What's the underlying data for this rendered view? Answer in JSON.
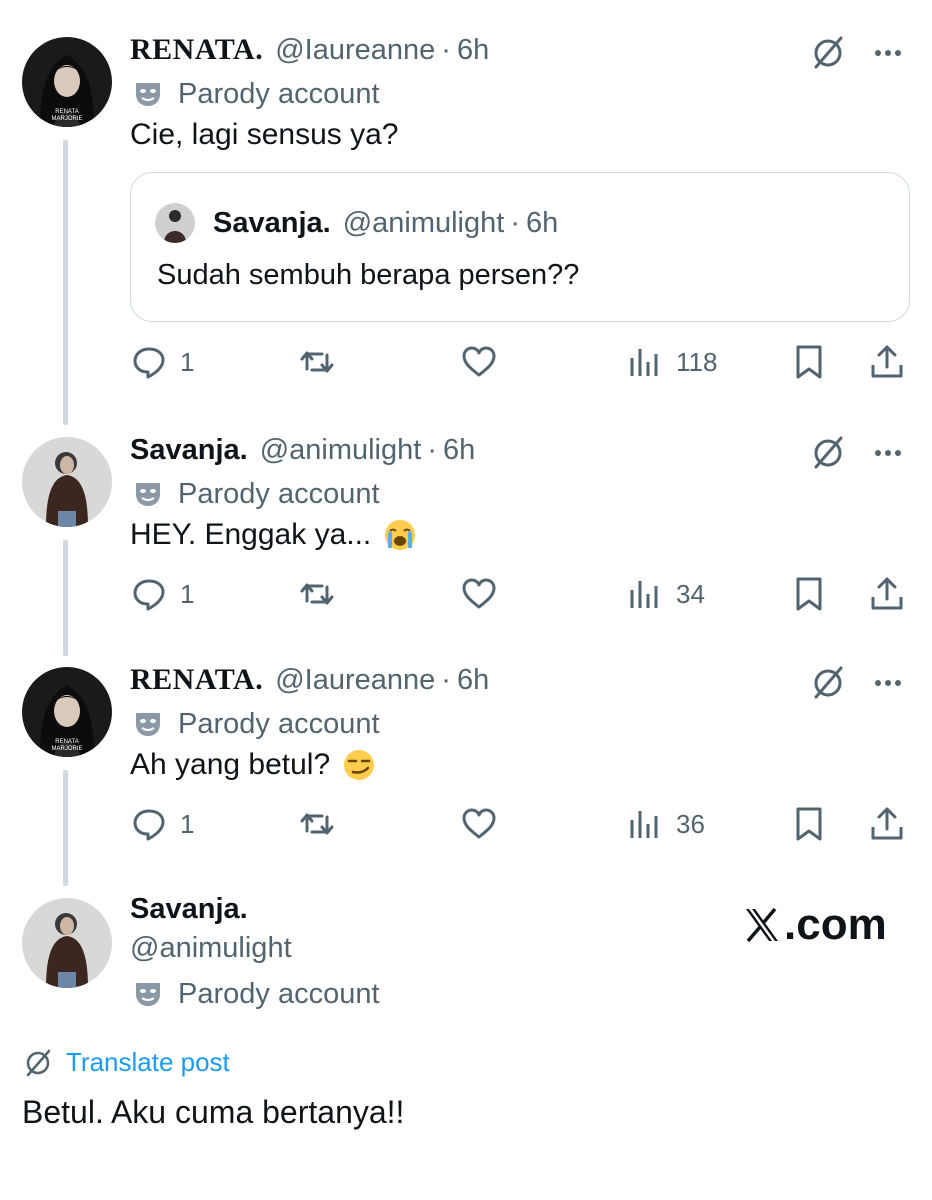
{
  "tweets": [
    {
      "name": "RENATA.",
      "handle": "@Iaureanne",
      "separator": "·",
      "time": "6h",
      "parody": "Parody account",
      "text": "Cie, lagi sensus ya?",
      "avatar_caption_1": "RENATA",
      "avatar_caption_2": "MARJORIE",
      "quote": {
        "name": "Savanja.",
        "handle": "@animulight",
        "separator": "·",
        "time": "6h",
        "text": "Sudah sembuh berapa persen??"
      },
      "replies": "1",
      "views": "118"
    },
    {
      "name": "Savanja.",
      "handle": "@animulight",
      "separator": "·",
      "time": "6h",
      "parody": "Parody account",
      "text": "HEY. Enggak ya...",
      "emoji": "loudly-crying-face",
      "replies": "1",
      "views": "34"
    },
    {
      "name": "RENATA.",
      "handle": "@Iaureanne",
      "separator": "·",
      "time": "6h",
      "parody": "Parody account",
      "text": "Ah yang betul?",
      "emoji": "smirking-face",
      "avatar_caption_1": "RENATA",
      "avatar_caption_2": "MARJORIE",
      "replies": "1",
      "views": "36"
    }
  ],
  "main_post": {
    "name": "Savanja.",
    "handle": "@animulight",
    "parody": "Parody account",
    "translate": "Translate post",
    "text": "Betul. Aku cuma bertanya!!"
  },
  "watermark": {
    "text": ".com"
  },
  "colors": {
    "text": "#0f1419",
    "secondary": "#536471",
    "link": "#1d9bf0",
    "border": "#cfd9de"
  }
}
